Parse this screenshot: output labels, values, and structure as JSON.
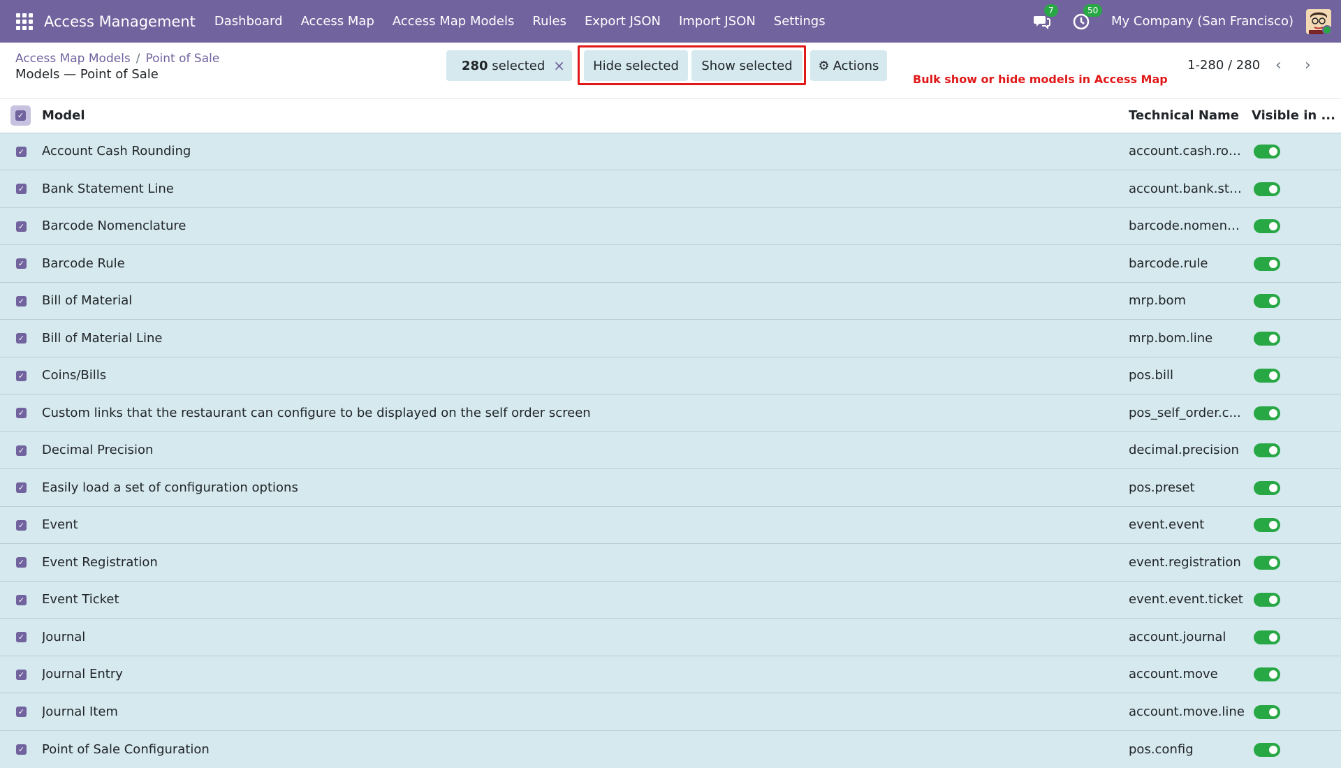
{
  "app": {
    "title": "Access Management",
    "menu": [
      "Dashboard",
      "Access Map",
      "Access Map Models",
      "Rules",
      "Export JSON",
      "Import JSON",
      "Settings"
    ],
    "messages_badge": "7",
    "activities_badge": "50",
    "company": "My Company (San Francisco)"
  },
  "breadcrumb": {
    "parent": "Access Map Models",
    "current": "Point of Sale",
    "subtitle": "Models — Point of Sale"
  },
  "selection": {
    "count": "280",
    "label": "selected",
    "clear": "×"
  },
  "buttons": {
    "hide": "Hide selected",
    "show": "Show selected",
    "actions": "Actions",
    "gear": "⚙"
  },
  "annotation": "Bulk show or hide models in Access Map",
  "pager": {
    "range": "1-280 / 280",
    "prev": "‹",
    "next": "›"
  },
  "table": {
    "columns": {
      "model": "Model",
      "technical": "Technical Name",
      "visible": "Visible in ..."
    },
    "rows": [
      {
        "model": "Account Cash Rounding",
        "technical": "account.cash.rou...",
        "visible": true
      },
      {
        "model": "Bank Statement Line",
        "technical": "account.bank.sta...",
        "visible": true
      },
      {
        "model": "Barcode Nomenclature",
        "technical": "barcode.nomenc...",
        "visible": true
      },
      {
        "model": "Barcode Rule",
        "technical": "barcode.rule",
        "visible": true
      },
      {
        "model": "Bill of Material",
        "technical": "mrp.bom",
        "visible": true
      },
      {
        "model": "Bill of Material Line",
        "technical": "mrp.bom.line",
        "visible": true
      },
      {
        "model": "Coins/Bills",
        "technical": "pos.bill",
        "visible": true
      },
      {
        "model": "Custom links that the restaurant can configure to be displayed on the self order screen",
        "technical": "pos_self_order.c...",
        "visible": true
      },
      {
        "model": "Decimal Precision",
        "technical": "decimal.precision",
        "visible": true
      },
      {
        "model": "Easily load a set of configuration options",
        "technical": "pos.preset",
        "visible": true
      },
      {
        "model": "Event",
        "technical": "event.event",
        "visible": true
      },
      {
        "model": "Event Registration",
        "technical": "event.registration",
        "visible": true
      },
      {
        "model": "Event Ticket",
        "technical": "event.event.ticket",
        "visible": true
      },
      {
        "model": "Journal",
        "technical": "account.journal",
        "visible": true
      },
      {
        "model": "Journal Entry",
        "technical": "account.move",
        "visible": true
      },
      {
        "model": "Journal Item",
        "technical": "account.move.line",
        "visible": true
      },
      {
        "model": "Point of Sale Configuration",
        "technical": "pos.config",
        "visible": true
      }
    ]
  },
  "colors": {
    "brand": "#71639e",
    "row_bg": "#d5e9ee",
    "toggle_on": "#28a745",
    "highlight": "#e01818"
  }
}
